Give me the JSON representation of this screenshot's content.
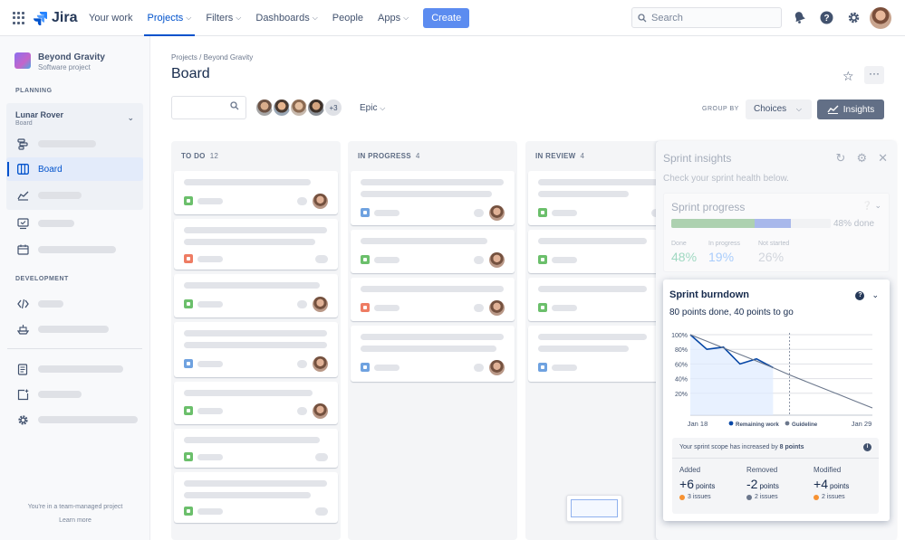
{
  "topbar": {
    "brand": "Jira",
    "nav": [
      {
        "label": "Your work",
        "chevron": false,
        "active": false
      },
      {
        "label": "Projects",
        "chevron": true,
        "active": true
      },
      {
        "label": "Filters",
        "chevron": true,
        "active": false
      },
      {
        "label": "Dashboards",
        "chevron": true,
        "active": false
      },
      {
        "label": "People",
        "chevron": false,
        "active": false
      },
      {
        "label": "Apps",
        "chevron": true,
        "active": false
      }
    ],
    "create_label": "Create",
    "search_placeholder": "Search",
    "icons": [
      "notifications-icon",
      "help-icon",
      "settings-icon"
    ]
  },
  "sidebar": {
    "project_name": "Beyond Gravity",
    "project_type": "Software project",
    "planning_heading": "PLANNING",
    "board_selector": {
      "title": "Lunar Rover",
      "subtitle": "Board"
    },
    "board_label": "Board",
    "development_heading": "DEVELOPMENT",
    "footer_text": "You're in a team-managed project",
    "footer_link": "Learn more"
  },
  "page": {
    "breadcrumb": "Projects / Beyond Gravity",
    "title": "Board",
    "avatars_more": "+3",
    "epic_label": "Epic",
    "group_by_label": "GROUP BY",
    "group_by_value": "Choices",
    "insights_label": "Insights"
  },
  "columns": [
    {
      "name": "TO DO",
      "count": "12"
    },
    {
      "name": "IN PROGRESS",
      "count": "4"
    },
    {
      "name": "IN REVIEW",
      "count": "4"
    }
  ],
  "insights": {
    "title": "Sprint insights",
    "subtitle": "Check your sprint health below.",
    "progress": {
      "title": "Sprint progress",
      "done_fraction": 0.52,
      "in_progress_fraction": 0.23,
      "done_label": "48% done",
      "stats": [
        {
          "label": "Done",
          "value": "48%",
          "color": "#36b37e"
        },
        {
          "label": "In progress",
          "value": "19%",
          "color": "#4c9aff"
        },
        {
          "label": "Not started",
          "value": "26%",
          "color": "#a5adba"
        }
      ]
    },
    "burndown": {
      "title": "Sprint burndown",
      "subtitle": "80 points done, 40 points to go",
      "scope_message": "Your sprint scope has increased by",
      "scope_points": "8 points",
      "changes": [
        {
          "heading": "Added",
          "sign": "+",
          "number": "6",
          "unit": "points",
          "issues": "3 issues",
          "dot": "#f79232"
        },
        {
          "heading": "Removed",
          "sign": "-",
          "number": "2",
          "unit": "points",
          "issues": "2 issues",
          "dot": "#6b778c"
        },
        {
          "heading": "Modified",
          "sign": "+",
          "number": "4",
          "unit": "points",
          "issues": "2 issues",
          "dot": "#f79232"
        }
      ]
    }
  },
  "chart_data": {
    "type": "line",
    "x_tick_labels": [
      "Jan 18",
      "Jan 29"
    ],
    "y_tick_labels": [
      "100%",
      "80%",
      "60%",
      "40%",
      "20%"
    ],
    "ylim": [
      0,
      100
    ],
    "x": [
      0,
      1,
      2,
      3,
      4,
      5,
      6,
      7,
      8,
      9,
      10,
      11
    ],
    "series": [
      {
        "name": "Remaining work",
        "color": "#0747a6",
        "values": [
          100,
          80,
          83,
          60,
          67,
          55
        ]
      },
      {
        "name": "Guideline",
        "color": "#6b778c",
        "values": [
          100,
          91,
          82,
          73,
          64,
          55,
          45,
          36,
          27,
          18,
          9,
          0
        ]
      }
    ],
    "today_index": 6,
    "legend_position": "bottom"
  },
  "colors": {
    "accent": "#0052cc",
    "create": "#5c8cf0",
    "insights_button": "#626f86"
  }
}
